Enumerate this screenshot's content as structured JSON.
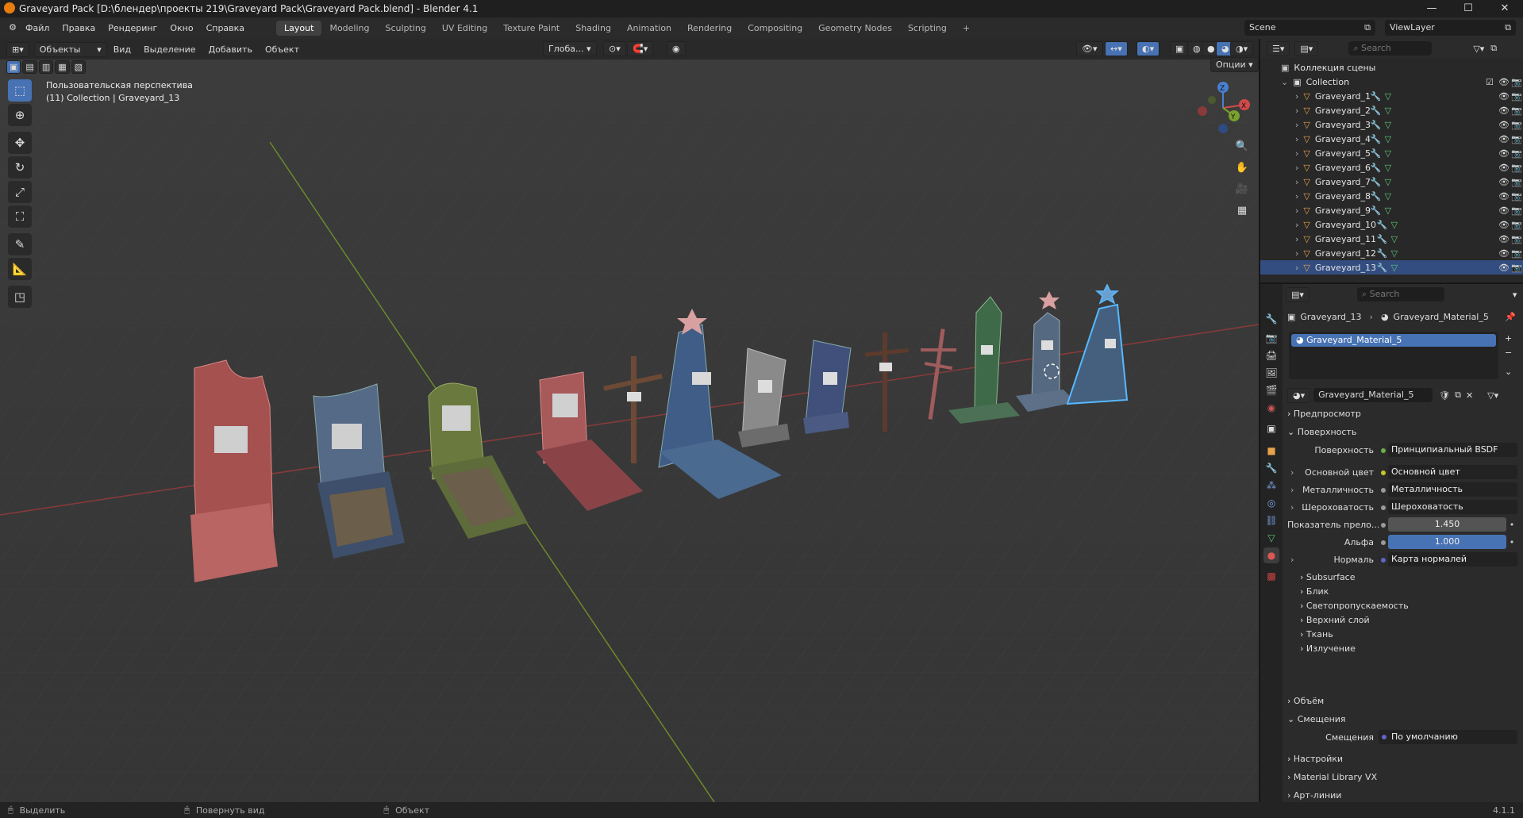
{
  "window": {
    "title": "Graveyard Pack [D:\\блендер\\проекты 219\\Graveyard Pack\\Graveyard Pack.blend] - Blender 4.1",
    "minimize": "—",
    "maximize": "☐",
    "close": "✕"
  },
  "menu": [
    "Файл",
    "Правка",
    "Рендеринг",
    "Окно",
    "Справка"
  ],
  "workspaces": [
    "Layout",
    "Modeling",
    "Sculpting",
    "UV Editing",
    "Texture Paint",
    "Shading",
    "Animation",
    "Rendering",
    "Compositing",
    "Geometry Nodes",
    "Scripting"
  ],
  "active_workspace": "Layout",
  "add_workspace": "+",
  "scene": {
    "name": "Scene",
    "view_layer": "ViewLayer"
  },
  "viewport_header": {
    "mode": "Объекты",
    "menus": [
      "Вид",
      "Выделение",
      "Добавить",
      "Объект"
    ],
    "transform_orientation": "Глоба...",
    "options": "Опции"
  },
  "viewport_overlay": {
    "line1": "Пользовательская перспектива",
    "line2": "(11) Collection | Graveyard_13"
  },
  "gizmo": {
    "x": "X",
    "y": "Y",
    "z": "Z"
  },
  "outliner": {
    "search_placeholder": "Search",
    "scene_collection": "Коллекция сцены",
    "collection": "Collection",
    "objects": [
      "Graveyard_1",
      "Graveyard_2",
      "Graveyard_3",
      "Graveyard_4",
      "Graveyard_5",
      "Graveyard_6",
      "Graveyard_7",
      "Graveyard_8",
      "Graveyard_9",
      "Graveyard_10",
      "Graveyard_11",
      "Graveyard_12",
      "Graveyard_13"
    ],
    "selected": "Graveyard_13"
  },
  "properties": {
    "search_placeholder": "Search",
    "breadcrumb_object": "Graveyard_13",
    "breadcrumb_material": "Graveyard_Material_5",
    "slot": "Graveyard_Material_5",
    "material_name": "Graveyard_Material_5",
    "sections": {
      "preview": "Предпросмотр",
      "surface": "Поверхность",
      "volume": "Объём",
      "displacement": "Смещения",
      "settings": "Настройки",
      "matlib": "Material Library VX",
      "lineart": "Арт-линии"
    },
    "surface_rows": [
      {
        "label": "Поверхность",
        "value": "Принципиальный BSDF",
        "kind": "node",
        "color": "#6ab04c"
      },
      {
        "label": "Основной цвет",
        "value": "Основной цвет",
        "kind": "node",
        "color": "#c7c729"
      },
      {
        "label": "Металличность",
        "value": "Металличность",
        "kind": "node",
        "color": "#9a9a9a"
      },
      {
        "label": "Шероховатость",
        "value": "Шероховатость",
        "kind": "node",
        "color": "#9a9a9a"
      },
      {
        "label": "Показатель прело...",
        "value": "1.450",
        "kind": "num"
      },
      {
        "label": "Альфа",
        "value": "1.000",
        "kind": "num_active"
      },
      {
        "label": "Нормаль",
        "value": "Карта нормалей",
        "kind": "node",
        "color": "#6363c7"
      }
    ],
    "subpanels": [
      "Subsurface",
      "Блик",
      "Светопропускаемость",
      "Верхний слой",
      "Ткань",
      "Излучение"
    ],
    "displacement_row": {
      "label": "Смещения",
      "value": "По умолчанию",
      "color": "#6363c7"
    }
  },
  "statusbar": {
    "select": "Выделить",
    "rotate": "Повернуть вид",
    "object": "Объект",
    "version": "4.1.1"
  }
}
